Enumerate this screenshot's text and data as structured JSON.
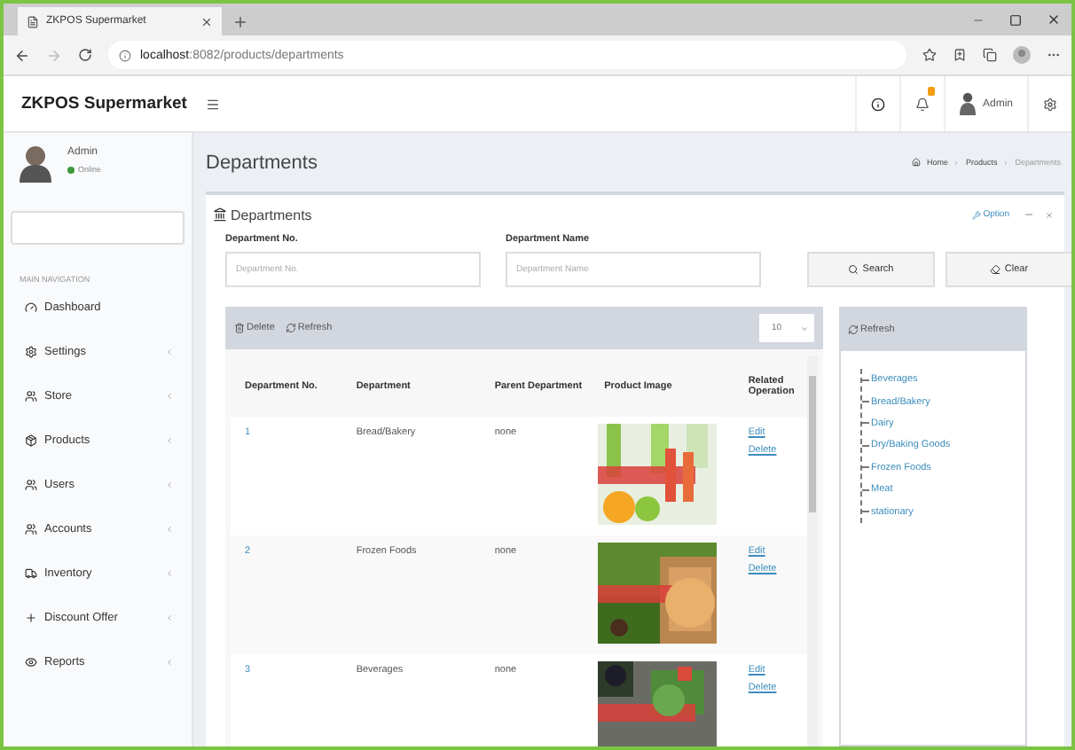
{
  "browser": {
    "tab_title": "ZKPOS Supermarket",
    "url": "**localhost**:8082/products/departments"
  },
  "header": {
    "brand": "ZKPOS Supermarket",
    "user": "Admin"
  },
  "sidebar": {
    "user": {
      "name": "Admin",
      "status": "Online"
    },
    "nav_heading": "MAIN NAVIGATION",
    "items": [
      {
        "label": "Dashboard",
        "expandable": false
      },
      {
        "label": "Settings",
        "expandable": true
      },
      {
        "label": "Store",
        "expandable": true
      },
      {
        "label": "Products",
        "expandable": true
      },
      {
        "label": "Users",
        "expandable": true
      },
      {
        "label": "Accounts",
        "expandable": true
      },
      {
        "label": "Inventory",
        "expandable": true
      },
      {
        "label": "Discount Offer",
        "expandable": true
      },
      {
        "label": "Reports",
        "expandable": true
      }
    ]
  },
  "page": {
    "title": "Departments",
    "breadcrumb": [
      "Home",
      "Products",
      "Departments"
    ]
  },
  "box": {
    "title": "Departments",
    "option": "Option",
    "filters": [
      {
        "label": "Department No.",
        "placeholder": "Department No."
      },
      {
        "label": "Department Name",
        "placeholder": "Department Name"
      }
    ],
    "buttons": [
      "Search",
      "Clear"
    ]
  },
  "toolbar": {
    "delete": "Delete",
    "refresh": "Refresh",
    "page_size": "10"
  },
  "table": {
    "columns": [
      "Department No.",
      "Department",
      "Parent Department",
      "Product Image",
      "Related Operation"
    ],
    "rows": [
      {
        "no": "1",
        "department": "Bread/Bakery",
        "parent": "none",
        "actions": [
          "Edit",
          "Delete"
        ]
      },
      {
        "no": "2",
        "department": "Frozen Foods",
        "parent": "none",
        "actions": [
          "Edit",
          "Delete"
        ]
      },
      {
        "no": "3",
        "department": "Beverages",
        "parent": "none",
        "actions": [
          "Edit",
          "Delete"
        ]
      }
    ]
  },
  "tree": {
    "refresh": "Refresh",
    "items": [
      "Beverages",
      "Bread/Bakery",
      "Dairy",
      "Dry/Baking Goods",
      "Frozen Foods",
      "Meat",
      "stationary"
    ]
  }
}
